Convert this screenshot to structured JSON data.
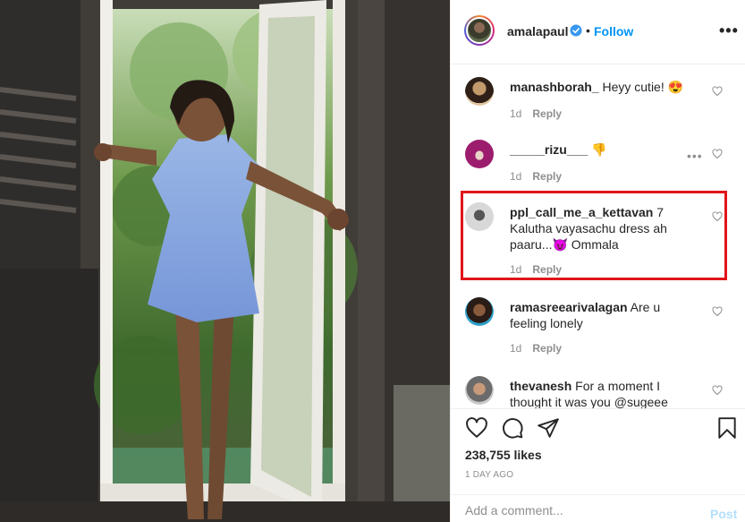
{
  "post": {
    "username": "amalapaul",
    "follow_label": "Follow",
    "separator": "•",
    "more_glyph": "•••",
    "verified_color": "#3897f0",
    "accent_color": "#0095f6"
  },
  "comments": [
    {
      "username": "manashborah_",
      "text": " Heyy cutie! 😍",
      "time": "1d",
      "reply_label": "Reply"
    },
    {
      "username": "_____rizu___",
      "text": " 👎",
      "time": "1d",
      "reply_label": "Reply",
      "more_glyph": "•••"
    },
    {
      "username": "ppl_call_me_a_kettavan",
      "text": " 7 Kalutha vayasachu dress ah paaru...😈 Ommala",
      "time": "1d",
      "reply_label": "Reply",
      "highlighted": true
    },
    {
      "username": "ramasreearivalagan",
      "text": " Are u feeling lonely",
      "time": "1d",
      "reply_label": "Reply"
    },
    {
      "username": "thevanesh",
      "text": " For a moment I thought it was you @sugeee",
      "time": "",
      "reply_label": ""
    }
  ],
  "actions": {
    "icons": [
      "heart-icon",
      "comment-icon",
      "share-icon",
      "bookmark-icon"
    ],
    "likes": "238,755 likes",
    "time_ago": "1 DAY AGO"
  },
  "add_comment": {
    "placeholder": "Add a comment...",
    "post_label": "Post"
  },
  "highlight_color": "#e0151b"
}
